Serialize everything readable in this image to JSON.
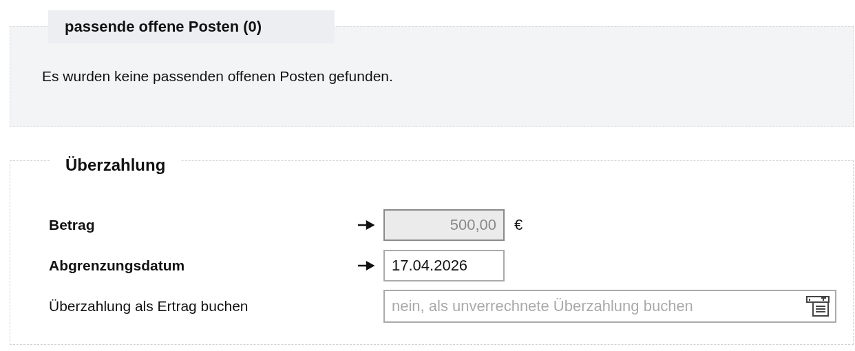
{
  "matching_items": {
    "title": "passende offene Posten (0)",
    "message": "Es wurden keine passenden offenen Posten gefunden."
  },
  "overpayment": {
    "title": "Überzahlung",
    "fields": [
      {
        "kind": "amount",
        "label": "Betrag",
        "required": true,
        "disabled": true,
        "value": "500,00",
        "unit": "€"
      },
      {
        "kind": "date",
        "label": "Abgrenzungsdatum",
        "required": true,
        "disabled": false,
        "value": "17.04.2026"
      },
      {
        "kind": "select",
        "label": "Überzahlung als Ertrag buchen",
        "required": false,
        "placeholder": "nein, als unverrechnete Überzahlung buchen"
      }
    ]
  }
}
